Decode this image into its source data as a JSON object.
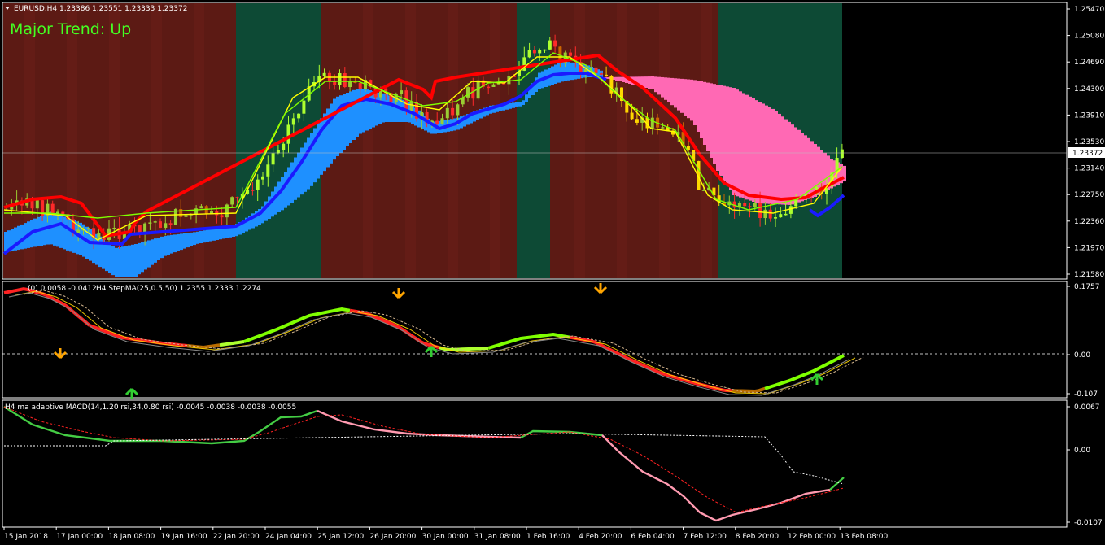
{
  "main": {
    "header": "EURUSD,H4  1.23386 1.23551 1.23333 1.23372",
    "trend_label": "Major Trend: Up",
    "current_price_label": "1.23372",
    "y_labels": [
      "1.25470",
      "1.25080",
      "1.24690",
      "1.24300",
      "1.23910",
      "1.23530",
      "1.23140",
      "1.22750",
      "1.22360",
      "1.21970",
      "1.21580"
    ]
  },
  "ind1": {
    "header": "H4 StepMA(25,0.5,50) 1.2355 1.2333 1.2274",
    "header_prefix": "(0) 0.0058 -0.0412",
    "y_labels": [
      "0.1757",
      "0.00",
      "-0.107"
    ]
  },
  "ind2": {
    "header": "H4 ma adaptive MACD(14,1.20 rsi,34,0.80 rsi) -0.0045 -0.0038 -0.0038 -0.0055",
    "y_labels": [
      "0.0067",
      "0.00",
      "-0.0107"
    ]
  },
  "x_labels": [
    "15 Jan 2018",
    "17 Jan 00:00",
    "18 Jan 08:00",
    "19 Jan 16:00",
    "22 Jan 20:00",
    "24 Jan 04:00",
    "25 Jan 12:00",
    "26 Jan 20:00",
    "30 Jan 00:00",
    "31 Jan 08:00",
    "1 Feb 16:00",
    "4 Feb 20:00",
    "6 Feb 04:00",
    "7 Feb 12:00",
    "8 Feb 20:00",
    "12 Feb 00:00",
    "13 Feb 08:00"
  ],
  "colors": {
    "bg_red": "#5c1a14",
    "bg_red2": "#6b1f17",
    "bg_green": "#0d4a35",
    "bull": "#9acd32",
    "bull_lime": "#adff2f",
    "bear": "#ff2a2a",
    "blue_band": "#1e90ff",
    "pink_band": "#ff69b4",
    "navy_line": "#1a1aff",
    "red_line": "#ff0000",
    "signal_orange": "#ffa500",
    "signal_green": "#32cd32"
  },
  "chart_data": [
    {
      "type": "line",
      "title": "EURUSD,H4",
      "ylim": [
        1.2158,
        1.2547
      ],
      "x": [
        "15 Jan 2018",
        "17 Jan 00:00",
        "18 Jan 08:00",
        "19 Jan 16:00",
        "22 Jan 20:00",
        "24 Jan 04:00",
        "25 Jan 12:00",
        "26 Jan 20:00",
        "30 Jan 00:00",
        "31 Jan 08:00",
        "1 Feb 16:00",
        "4 Feb 20:00",
        "6 Feb 04:00",
        "7 Feb 12:00",
        "8 Feb 20:00",
        "12 Feb 00:00",
        "13 Feb 08:00"
      ],
      "series": [
        {
          "values": [
            1.2265,
            1.2255,
            1.2245,
            1.2255,
            1.226,
            1.23,
            1.243,
            1.242,
            1.237,
            1.241,
            1.244,
            1.247,
            1.24,
            1.23,
            1.225,
            1.226,
            1.2337
          ]
        }
      ],
      "current_price": 1.23372
    },
    {
      "type": "line",
      "title": "H4 StepMA(25,0.5,50)",
      "ylim": [
        -0.107,
        0.1757
      ],
      "series": [
        {
          "values": [
            0.17,
            0.09,
            0.03,
            0.02,
            0.03,
            0.11,
            0.125,
            0.08,
            0.01,
            0.015,
            0.05,
            0.04,
            -0.02,
            -0.08,
            -0.095,
            -0.06,
            0.0
          ]
        }
      ]
    },
    {
      "type": "line",
      "title": "H4 ma adaptive MACD",
      "ylim": [
        -0.0107,
        0.0067
      ],
      "series": [
        {
          "values": [
            0.006,
            0.002,
            0.0015,
            0.0012,
            0.0012,
            0.0035,
            0.0052,
            0.0028,
            0.0025,
            0.0022,
            0.003,
            0.0032,
            -0.001,
            -0.008,
            -0.0105,
            -0.007,
            -0.0045
          ]
        }
      ]
    }
  ]
}
